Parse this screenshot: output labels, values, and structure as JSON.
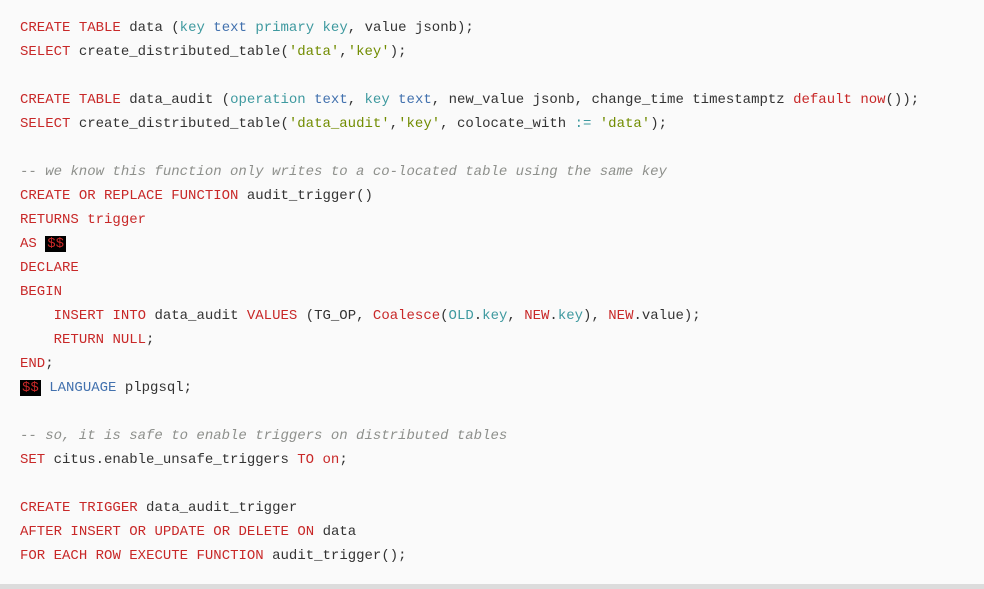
{
  "code": {
    "l01": {
      "t01": "CREATE",
      "t02": "TABLE",
      "t03": "data",
      "t04": "(",
      "t05": "key",
      "t06": "text",
      "t07": "primary",
      "t08": "key",
      "t09": ",",
      "t10": "value",
      "t11": "jsonb",
      "t12": ");"
    },
    "l02": {
      "t01": "SELECT",
      "t02": "create_distributed_table(",
      "t03": "'data'",
      "t04": ",",
      "t05": "'key'",
      "t06": ");"
    },
    "l03": "",
    "l04": {
      "t01": "CREATE",
      "t02": "TABLE",
      "t03": "data_audit",
      "t04": "(",
      "t05": "operation",
      "t06": "text",
      "t07": ",",
      "t08": "key",
      "t09": "text",
      "t10": ",",
      "t11": "new_value",
      "t12": "jsonb",
      "t13": ",",
      "t14": "change_time",
      "t15": "timestamptz",
      "t16": "default",
      "t17": "now",
      "t18": "());"
    },
    "l05": {
      "t01": "SELECT",
      "t02": "create_distributed_table(",
      "t03": "'data_audit'",
      "t04": ",",
      "t05": "'key'",
      "t06": ",",
      "t07": "colocate_with",
      "t08": ":=",
      "t09": "'data'",
      "t10": ");"
    },
    "l06": "",
    "l07": {
      "t01": "-- we know this function only writes to a co-located table using the same key"
    },
    "l08": {
      "t01": "CREATE",
      "t02": "OR REPLACE",
      "t03": "FUNCTION",
      "t04": "audit_trigger()"
    },
    "l09": {
      "t01": "RETURNS",
      "t02": "trigger"
    },
    "l10": {
      "t01": "AS",
      "t02": "$$"
    },
    "l11": {
      "t01": "DECLARE"
    },
    "l12": {
      "t01": "BEGIN"
    },
    "l13": {
      "t01": "INSERT",
      "t02": "INTO",
      "t03": "data_audit",
      "t04": "VALUES",
      "t05": "(TG_OP,",
      "t06": "Coalesce",
      "t07": "(",
      "t08": "OLD",
      "t09": ".",
      "t10": "key",
      "t11": ",",
      "t12": "NEW",
      "t13": ".",
      "t14": "key",
      "t15": "),",
      "t16": "NEW",
      "t17": ".",
      "t18": "value",
      "t19": ");"
    },
    "l14": {
      "t01": "RETURN",
      "t02": "NULL",
      "t03": ";"
    },
    "l15": {
      "t01": "END",
      "t02": ";"
    },
    "l16": {
      "t01": "$$",
      "t02": "LANGUAGE",
      "t03": "plpgsql;"
    },
    "l17": "",
    "l18": {
      "t01": "-- so, it is safe to enable triggers on distributed tables"
    },
    "l19": {
      "t01": "SET",
      "t02": "citus.enable_unsafe_triggers",
      "t03": "TO",
      "t04": "on",
      "t05": ";"
    },
    "l20": "",
    "l21": {
      "t01": "CREATE",
      "t02": "TRIGGER",
      "t03": "data_audit_trigger"
    },
    "l22": {
      "t01": "AFTER",
      "t02": "INSERT",
      "t03": "OR",
      "t04": "UPDATE",
      "t05": "OR",
      "t06": "DELETE",
      "t07": "ON",
      "t08": "data"
    },
    "l23": {
      "t01": "FOR",
      "t02": "EACH",
      "t03": "ROW",
      "t04": "EXECUTE",
      "t05": "FUNCTION",
      "t06": "audit_trigger();"
    }
  }
}
